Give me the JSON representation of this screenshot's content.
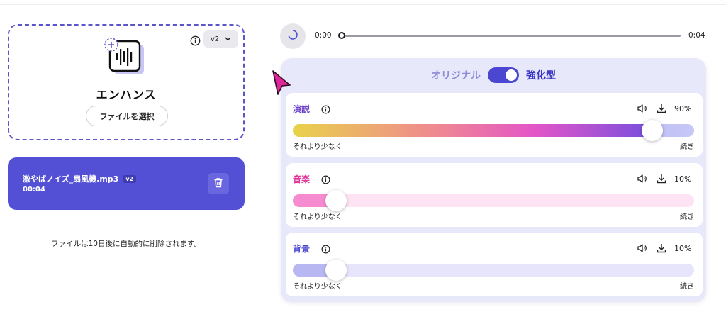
{
  "upload": {
    "version_value": "v2",
    "title": "エンハンス",
    "select_button": "ファイルを選択"
  },
  "file": {
    "name": "激やばノイズ_扇風機.mp3",
    "badge": "v2",
    "duration": "00:04"
  },
  "expiry_note": "ファイルは10日後に自動的に削除されます。",
  "player": {
    "current_time": "0:00",
    "total_time": "0:04",
    "progress": 0
  },
  "mode": {
    "original_label": "オリジナル",
    "enhanced_label": "強化型",
    "enhanced_on": true
  },
  "tracks": [
    {
      "name": "演説",
      "name_color": "#6a3fc9",
      "percent_label": "90%",
      "value": 0.9,
      "less_label": "それより少なく",
      "more_label": "続き"
    },
    {
      "name": "音楽",
      "name_color": "#e23a9b",
      "percent_label": "10%",
      "value": 0.1,
      "less_label": "それより少なく",
      "more_label": "続き"
    },
    {
      "name": "背景",
      "name_color": "#4b47d1",
      "percent_label": "10%",
      "value": 0.1,
      "less_label": "それより少なく",
      "more_label": "続き"
    }
  ],
  "colors": {
    "accent": "#5350d6",
    "panel_bg": "#e8e8fb",
    "cursor": "#e0249a"
  }
}
